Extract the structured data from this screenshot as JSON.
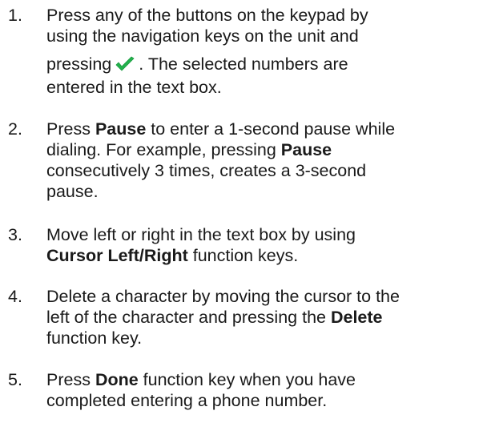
{
  "steps": [
    {
      "number": "1.",
      "lines": [
        [
          "Press any of the buttons on the keypad by"
        ],
        [
          "using the navigation keys on the unit and"
        ],
        [
          "pressing",
          ". The selected numbers are"
        ],
        [
          "entered in the text box."
        ]
      ]
    },
    {
      "number": "2.",
      "lines": [
        [
          "Press ",
          "Pause",
          " to enter a 1-second pause while"
        ],
        [
          "dialing. For example, pressing ",
          "Pause"
        ],
        [
          "consecutively 3 times, creates a 3-second"
        ],
        [
          "pause."
        ]
      ]
    },
    {
      "number": "3.",
      "lines": [
        [
          "Move left or right in the text box by using"
        ],
        [
          "Cursor Left/Right",
          " function keys."
        ]
      ]
    },
    {
      "number": "4.",
      "lines": [
        [
          "Delete a character by moving the cursor to the"
        ],
        [
          "left of the character and pressing the ",
          "Delete"
        ],
        [
          "function key."
        ]
      ]
    },
    {
      "number": "5.",
      "lines": [
        [
          "Press ",
          "Done",
          " function key when you have"
        ],
        [
          "completed entering a phone number."
        ]
      ]
    }
  ],
  "icons": {
    "checkmark": "checkmark-icon",
    "checkmark_color": "#22b14c"
  }
}
